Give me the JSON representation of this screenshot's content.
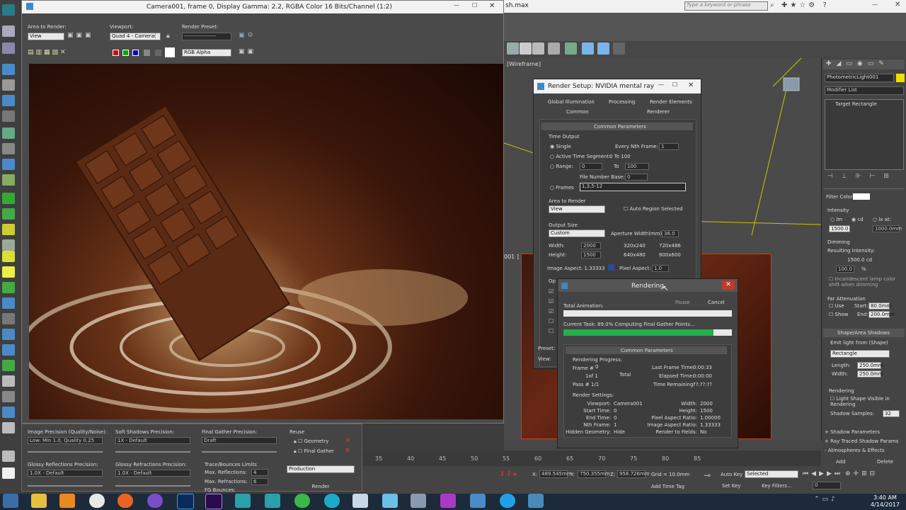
{
  "frame_window": {
    "title": "Camera001, frame 0, Display Gamma: 2.2, RGBA Color 16 Bits/Channel (1:2)",
    "area_to_render_label": "Area to Render:",
    "area_value": "View",
    "viewport_label": "Viewport:",
    "viewport_value": "Quad 4 - Camera(",
    "preset_label": "Render Preset:",
    "preset_value": "------------------",
    "channel_value": "RGB Alpha"
  },
  "bottom_panel": {
    "image_precision_label": "Image Precision (Quality/Noise):",
    "image_precision_value": "Low: Min 1.0, Quality 0.25",
    "soft_shadows_label": "Soft Shadows Precision:",
    "soft_shadows_value": "1X - Default",
    "final_gather_label": "Final Gather Precision:",
    "final_gather_value": "Draft",
    "reuse_label": "Reuse",
    "geometry_label": "Geometry",
    "final_gather_check_label": "Final Gather",
    "glossy_reflections_label": "Glossy Reflections Precision:",
    "glossy_reflections_value": "1.0X - Default",
    "glossy_refractions_label": "Glossy Refractions Precision:",
    "glossy_refractions_value": "1.0X - Default",
    "trace_label": "Trace/Bounces Limits",
    "max_reflections_label": "Max. Reflections:",
    "max_reflections_value": "4",
    "max_refractions_label": "Max. Refractions:",
    "max_refractions_value": "6",
    "fg_bounces_label": "FG Bounces:",
    "production_value": "Production",
    "render_button": "Render"
  },
  "max_main": {
    "title_fragment": "sh.max",
    "search_placeholder": "Type a keyword or phrase",
    "viewport_label_top": "[Wireframe]",
    "viewport_label_bottom": "001 ] [Re"
  },
  "command_panel": {
    "object_name": "PhotometricLight001",
    "modifier_list": "Modifier List",
    "stack_item": "Target Rectangle",
    "filter_color": "Filter Color:",
    "intensity": "Intensity",
    "lm": "lm",
    "cd": "cd",
    "lx_at": "lx at:",
    "intensity_value": "1500.0",
    "intensity_value2": "1000.0mm",
    "dimming": "Dimming",
    "resulting_intensity": "Resulting Intensity:",
    "resulting_value": "1500.0 cd",
    "dim_value": "100.0",
    "percent": "%",
    "incandescent": "Incandescent lamp color shift when dimming",
    "far_attenuation": "Far Attenuation",
    "use": "Use",
    "start": "Start:",
    "start_value": "80.0mm",
    "show": "Show",
    "end": "End:",
    "end_value": "200.0mm",
    "shape_rollout": "Shape/Area Shadows",
    "emit_light": "Emit light from (Shape)",
    "shape_value": "Rectangle",
    "length": "Length:",
    "length_value": "250.0mm",
    "width": "Width:",
    "width_value": "250.0mm",
    "rendering": "Rendering",
    "light_shape_visible": "Light Shape Visible in Rendering",
    "shadow_samples": "Shadow Samples:",
    "shadow_samples_value": "32",
    "shadow_params": "Shadow Parameters",
    "ray_traced": "Ray Traced Shadow Params",
    "atmospheres": "Atmospheres & Effects",
    "add": "Add",
    "delete": "Delete"
  },
  "render_setup": {
    "title": "Render Setup: NVIDIA mental ray",
    "tabs": [
      "Global Illumination",
      "Processing",
      "Render Elements"
    ],
    "tabs2": [
      "Common",
      "Renderer"
    ],
    "rollout": "Common Parameters",
    "time_output": "Time Output",
    "single": "Single",
    "every_nth": "Every Nth Frame:",
    "nth_value": "1",
    "active_segment": "Active Time Segment:",
    "active_value": "0 To 100",
    "range": "Range:",
    "range_from": "0",
    "to": "To",
    "range_to": "100",
    "file_number_base": "File Number Base:",
    "fnb_value": "0",
    "frames": "Frames",
    "frames_value": "1,3,5-12",
    "area_to_render": "Area to Render",
    "area_value": "View",
    "auto_region": "Auto Region Selected",
    "output_size": "Output Size",
    "output_value": "Custom",
    "aperture": "Aperture Width(mm):",
    "aperture_value": "36.0",
    "width_label": "Width:",
    "width_value": "2000",
    "height_label": "Height:",
    "height_value": "1500",
    "preset1": "320x240",
    "preset2": "720x486",
    "preset3": "640x480",
    "preset4": "800x600",
    "image_aspect": "Image Aspect: 1.33333",
    "pixel_aspect": "Pixel Aspect:",
    "pixel_aspect_value": "1.0",
    "op_fragment": "Op",
    "preset_fragment": "Preset:",
    "view_fragment": "View:"
  },
  "rendering_dialog": {
    "title": "Rendering",
    "pause": "Pause",
    "cancel": "Cancel",
    "total_animation": "Total Animation:",
    "current_task": "Current Task:",
    "task_text": "89.0%  Computing Final Gather Points...",
    "progress": 0.89,
    "rollout": "Common Parameters",
    "rendering_progress": "Rendering Progress:",
    "frame_hash": "Frame #",
    "frame_value": "0",
    "of_value": "1of 1",
    "total": "Total",
    "pass_hash": "Pass #",
    "pass_value": "1/1",
    "last_frame_time": "Last Frame Time:",
    "last_frame_value": "0:00:33",
    "elapsed_time": "Elapsed Time:",
    "elapsed_value": "0:00:00",
    "time_remaining": "Time Remaining:",
    "remaining_value": "??:??:??",
    "render_settings": "Render Settings:",
    "settings_left": [
      {
        "k": "Viewport:",
        "v": "Camera001"
      },
      {
        "k": "Start Time:",
        "v": "0"
      },
      {
        "k": "End Time:",
        "v": "0"
      },
      {
        "k": "Nth Frame:",
        "v": "1"
      },
      {
        "k": "Hidden Geometry:",
        "v": "Hide"
      }
    ],
    "settings_right": [
      {
        "k": "Width:",
        "v": "2000"
      },
      {
        "k": "Height:",
        "v": "1500"
      },
      {
        "k": "Pixel Aspect Ratio:",
        "v": "1.00000"
      },
      {
        "k": "Image Aspect Ratio:",
        "v": "1.33333"
      },
      {
        "k": "Render to Fields:",
        "v": "No"
      }
    ]
  },
  "timeline": {
    "ticks": [
      "35",
      "40",
      "45",
      "50",
      "55",
      "60",
      "65",
      "70",
      "75",
      "80",
      "85"
    ],
    "x_label": "X:",
    "x_value": "489.545mm",
    "y_label": "Y:",
    "y_value": "750.355mm",
    "z_label": "Z:",
    "z_value": "958.726mm",
    "grid": "Grid = 10.0mm",
    "add_time_tag": "Add Time Tag",
    "auto_key": "Auto Key",
    "selected": "Selected",
    "set_key": "Set Key",
    "key_filters": "Key Filters...",
    "frame_value": "0"
  },
  "taskbar": {
    "time": "3:40 AM",
    "date": "4/14/2017"
  }
}
